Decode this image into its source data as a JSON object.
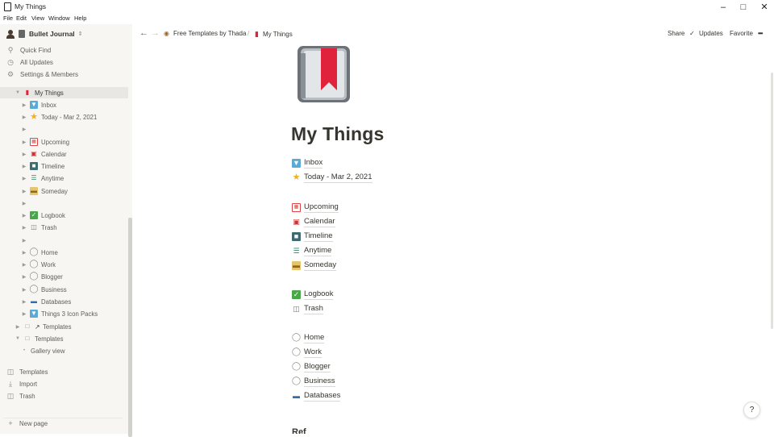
{
  "window": {
    "title": "My Things",
    "min_icon": "minimize-icon",
    "max_icon": "maximize-icon",
    "close_icon": "close-icon"
  },
  "menubar": [
    "File",
    "Edit",
    "View",
    "Window",
    "Help"
  ],
  "sidebar": {
    "workspace": "Bullet Journal",
    "nav": [
      {
        "label": "Quick Find",
        "icon": "search-icon"
      },
      {
        "label": "All Updates",
        "icon": "clock-icon"
      },
      {
        "label": "Settings & Members",
        "icon": "gear-icon"
      }
    ],
    "tree": [
      {
        "label": "My Things",
        "icon": "bookmark-book-icon",
        "expanded": true,
        "selected": true
      },
      {
        "label": "Inbox",
        "icon": "inbox-icon"
      },
      {
        "label": "Today - Mar 2, 2021",
        "icon": "star-icon"
      },
      {
        "label": "",
        "icon": ""
      },
      {
        "label": "Upcoming",
        "icon": "upcoming-calendar-icon"
      },
      {
        "label": "Calendar",
        "icon": "calendar-icon"
      },
      {
        "label": "Timeline",
        "icon": "timeline-icon"
      },
      {
        "label": "Anytime",
        "icon": "stack-icon"
      },
      {
        "label": "Someday",
        "icon": "someday-box-icon"
      },
      {
        "label": "",
        "icon": ""
      },
      {
        "label": "Logbook",
        "icon": "checkbox-icon"
      },
      {
        "label": "Trash",
        "icon": "trash-icon"
      },
      {
        "label": "",
        "icon": ""
      },
      {
        "label": "Home",
        "icon": "area-icon"
      },
      {
        "label": "Work",
        "icon": "area-icon"
      },
      {
        "label": "Blogger",
        "icon": "area-icon"
      },
      {
        "label": "Business",
        "icon": "area-icon"
      },
      {
        "label": "Databases",
        "icon": "folder-icon"
      },
      {
        "label": "Things 3 Icon Packs",
        "icon": "inbox-icon"
      },
      {
        "label": "Templates",
        "icon": "page-link-icon"
      },
      {
        "label": "Templates",
        "icon": "page-icon"
      },
      {
        "label": "Gallery view",
        "icon": ""
      }
    ],
    "bottom": [
      {
        "label": "Templates",
        "icon": "templates-icon"
      },
      {
        "label": "Import",
        "icon": "import-icon"
      },
      {
        "label": "Trash",
        "icon": "trash-icon"
      }
    ],
    "new_page": "New page"
  },
  "topbar": {
    "breadcrumb": [
      "Free Templates by Thada",
      "My Things"
    ],
    "breadcrumb_sep": "/",
    "share": "Share",
    "updates": "Updates",
    "favorite": "Favorite",
    "more": "•••"
  },
  "page": {
    "title": "My Things",
    "links": [
      {
        "label": "Inbox",
        "icon": "inbox-icon"
      },
      {
        "label": "Today - Mar 2, 2021",
        "icon": "star-icon"
      },
      {
        "label": "Upcoming",
        "icon": "upcoming-calendar-icon"
      },
      {
        "label": "Calendar",
        "icon": "calendar-icon"
      },
      {
        "label": "Timeline",
        "icon": "timeline-icon"
      },
      {
        "label": "Anytime",
        "icon": "stack-icon"
      },
      {
        "label": "Someday",
        "icon": "someday-box-icon"
      },
      {
        "label": "Logbook",
        "icon": "checkbox-icon"
      },
      {
        "label": "Trash",
        "icon": "trash-icon"
      },
      {
        "label": "Home",
        "icon": "area-icon"
      },
      {
        "label": "Work",
        "icon": "area-icon"
      },
      {
        "label": "Blogger",
        "icon": "area-icon"
      },
      {
        "label": "Business",
        "icon": "area-icon"
      },
      {
        "label": "Databases",
        "icon": "folder-icon"
      }
    ],
    "cutoff_heading": "Ref",
    "help": "?"
  },
  "colors": {
    "sidebar_bg": "#f7f6f3",
    "text": "#37352f",
    "muted": "#5f5e5b",
    "selected_row": "#e8e7e4",
    "bookmark_red": "#e0223d"
  }
}
